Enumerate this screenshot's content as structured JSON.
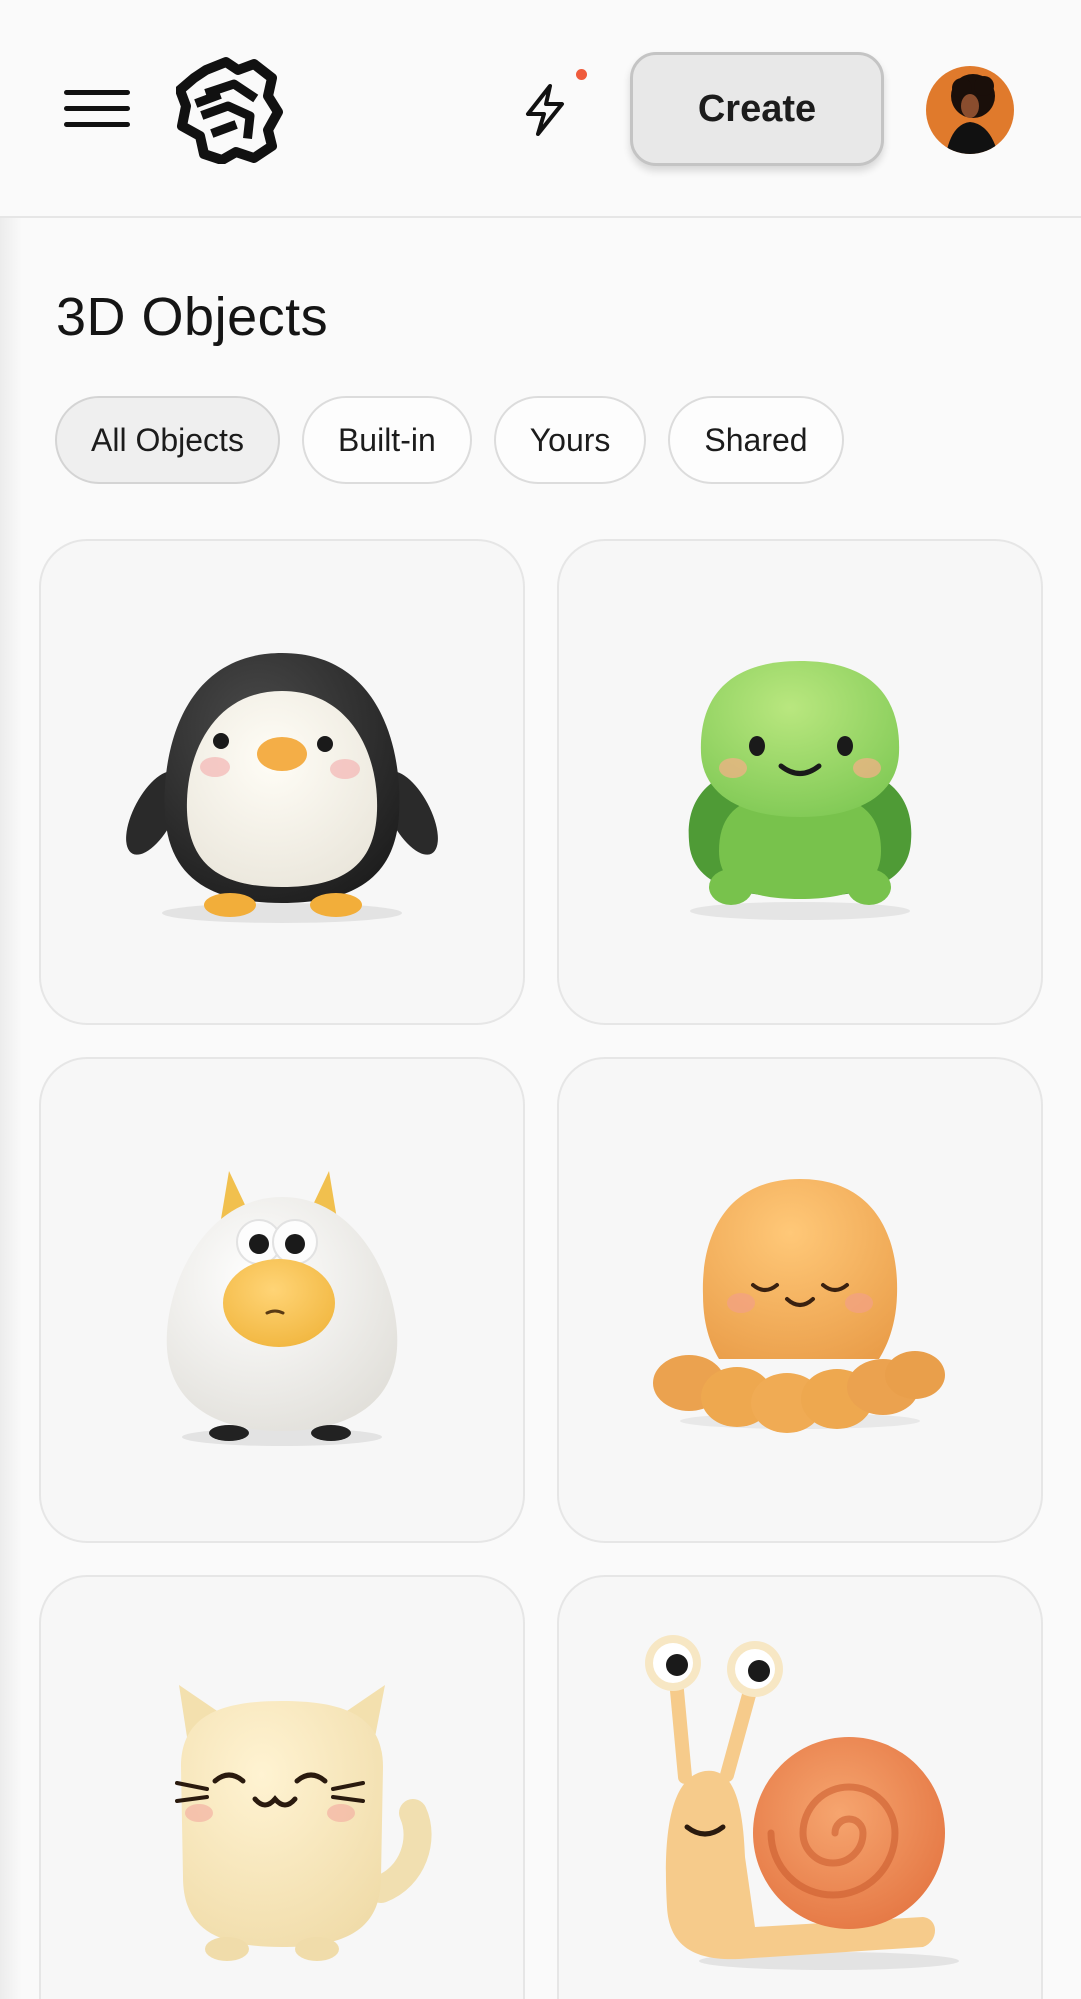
{
  "header": {
    "menu_icon": "hamburger-menu-icon",
    "logo_icon": "brand-logo-icon",
    "activity_icon": "lightning-bolt-icon",
    "notification_color": "#ef5b3c",
    "create_label": "Create",
    "avatar_icon": "user-avatar"
  },
  "page": {
    "title": "3D Objects"
  },
  "filters": {
    "active": "All Objects",
    "items": [
      {
        "label": "All Objects"
      },
      {
        "label": "Built-in"
      },
      {
        "label": "Yours"
      },
      {
        "label": "Shared"
      }
    ]
  },
  "objects": [
    {
      "name": "penguin",
      "icon": "penguin-3d-object"
    },
    {
      "name": "turtle",
      "icon": "turtle-3d-object"
    },
    {
      "name": "fluffy-creature",
      "icon": "fluffy-creature-3d-object"
    },
    {
      "name": "octopus",
      "icon": "octopus-3d-object"
    },
    {
      "name": "cat",
      "icon": "cat-3d-object"
    },
    {
      "name": "snail",
      "icon": "snail-3d-object"
    }
  ],
  "colors": {
    "background": "#fafafa",
    "card_background": "#f7f7f7",
    "avatar_background": "#e07a2c"
  }
}
